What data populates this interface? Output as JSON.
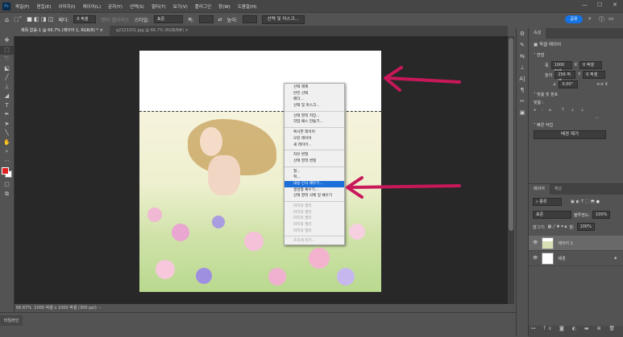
{
  "app": {
    "logo": "Ps",
    "menu": [
      "파일(F)",
      "편집(E)",
      "이미지(I)",
      "레이어(L)",
      "문자(Y)",
      "선택(S)",
      "필터(T)",
      "보기(V)",
      "플러그인",
      "창(W)",
      "도움말(H)"
    ],
    "window_controls": [
      "—",
      "☐",
      "✕"
    ]
  },
  "options": {
    "feather_label": "페더:",
    "feather_value": "0 픽셀",
    "antialias": "앤티 앨리어스",
    "style_label": "스타일:",
    "style_value": "표준",
    "width_label": "폭:",
    "height_label": "높이:",
    "select_mask_button": "선택 및 마스크...",
    "share_button": "공유"
  },
  "tabs": [
    {
      "label": "제목 없음-1 @ 66.7% (레이어 1, RGB/8) * ×"
    },
    {
      "label": "q2323201.jpg @ 66.7% (RGB/8#) ×"
    }
  ],
  "context_menu": {
    "groups": [
      [
        {
          "label": "선택 해제"
        },
        {
          "label": "반전 선택"
        },
        {
          "label": "페더..."
        },
        {
          "label": "선택 및 마스크..."
        }
      ],
      [
        {
          "label": "선택 영역 저장..."
        },
        {
          "label": "작업 패스 만들기..."
        }
      ],
      [
        {
          "label": "복사한 레이어"
        },
        {
          "label": "오린 레이어"
        },
        {
          "label": "새 레이어..."
        }
      ],
      [
        {
          "label": "자유 변형"
        },
        {
          "label": "선택 영역 변형"
        }
      ],
      [
        {
          "label": "칠..."
        },
        {
          "label": "획..."
        },
        {
          "label": "내용 인식 채우기...",
          "highlighted": true
        },
        {
          "label": "생성형 채우기..."
        },
        {
          "label": "선택 영역 삭제 및 채우기"
        }
      ],
      [
        {
          "label": "마지막 필터",
          "disabled": true
        },
        {
          "label": "마지막 필터",
          "disabled": true
        },
        {
          "label": "마지막 필터",
          "disabled": true
        },
        {
          "label": "마지막 필터",
          "disabled": true
        },
        {
          "label": "마지막 필터",
          "disabled": true
        }
      ],
      [
        {
          "label": "흐리게 하기...",
          "disabled": true
        }
      ]
    ]
  },
  "status": {
    "zoom": "66.67%",
    "doc_info": "1000 픽셀 x 1000 픽셀 (300 ppi)"
  },
  "timeline": "타임라인",
  "properties": {
    "tab": "속성",
    "layer_type": "픽셀 레이어",
    "transform": "변형",
    "w_label": "폭",
    "w": "1000 픽셀",
    "x_label": "X",
    "x": "0 픽셀",
    "h_label": "높이",
    "h": "256 픽셀",
    "y_label": "Y",
    "y": "0 픽셀",
    "angle": "0.00°",
    "align": "맞춤 및 분포",
    "align_label": "맞춤 :",
    "quick": "빠른 작업",
    "remove_bg": "배경 제거",
    "more": "..."
  },
  "layers": {
    "tabs": [
      "레이어",
      "채널"
    ],
    "filter": "종류",
    "blend": "표준",
    "opacity_label": "불투명도:",
    "opacity": "100%",
    "lock_label": "잠그기:",
    "fill_label": "칠:",
    "fill": "100%",
    "items": [
      {
        "name": "레이어 1",
        "selected": true
      },
      {
        "name": "배경",
        "locked": true
      }
    ]
  },
  "colors": {
    "accent": "#1473e6",
    "arrow": "#c8185a",
    "fg": "#e02020"
  }
}
